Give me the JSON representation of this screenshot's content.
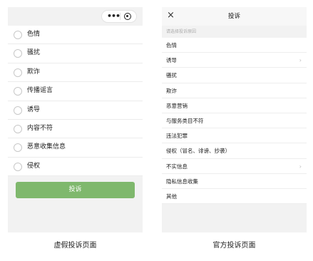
{
  "fake_page": {
    "options": [
      {
        "label": "色情"
      },
      {
        "label": "骚扰"
      },
      {
        "label": "欺诈"
      },
      {
        "label": "传播谣言"
      },
      {
        "label": "诱导"
      },
      {
        "label": "内容不符"
      },
      {
        "label": "恶意收集信息"
      },
      {
        "label": "侵权"
      }
    ],
    "submit_label": "投诉",
    "caption": "虚假投诉页面"
  },
  "official_page": {
    "title": "投诉",
    "close_glyph": "×",
    "hint": "请选择投诉原因",
    "items": [
      {
        "label": "色情",
        "chevron": ""
      },
      {
        "label": "诱导",
        "chevron": "›"
      },
      {
        "label": "骚扰",
        "chevron": ""
      },
      {
        "label": "欺诈",
        "chevron": ""
      },
      {
        "label": "恶意营销",
        "chevron": ""
      },
      {
        "label": "与服务类目不符",
        "chevron": ""
      },
      {
        "label": "违法犯罪",
        "chevron": ""
      },
      {
        "label": "侵权（冒名、诽谤、抄袭）",
        "chevron": ""
      },
      {
        "label": "不实信息",
        "chevron": "›"
      },
      {
        "label": "隐私信息收集",
        "chevron": ""
      },
      {
        "label": "其他",
        "chevron": ""
      }
    ],
    "caption": "官方投诉页面"
  },
  "capsule": {
    "more_glyph": "•••"
  },
  "colors": {
    "accent_green": "#7fb86d",
    "background": "#f2f2f2"
  }
}
